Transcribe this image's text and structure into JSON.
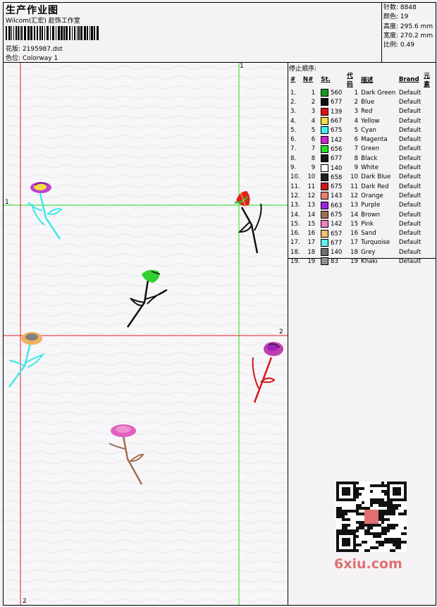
{
  "header": {
    "title": "生产作业图",
    "subtitle": "Wilcom(汇宏) 趁饰工作室",
    "design_label": "花版:",
    "design_value": "2195987.dst",
    "colorway_label": "色位:",
    "colorway_value": "Colorway 1"
  },
  "stats": [
    {
      "label": "针数:",
      "value": "8848"
    },
    {
      "label": "颜色:",
      "value": "19"
    },
    {
      "label": "高度:",
      "value": "295.6 mm"
    },
    {
      "label": "宽度:",
      "value": "270.2 mm"
    },
    {
      "label": "比例:",
      "value": "0.49"
    }
  ],
  "stop_sequence_label": "停止顺序:",
  "columns": [
    "#",
    "N#",
    "St.",
    "代码",
    "描述",
    "Brand",
    "元素"
  ],
  "threads": [
    {
      "idx": "1.",
      "n": "1",
      "color": "#1a9a1a",
      "st": "560",
      "code": "1",
      "desc": "Dark Green",
      "brand": "Default"
    },
    {
      "idx": "2.",
      "n": "2",
      "color": "#101010",
      "st": "677",
      "code": "2",
      "desc": "Blue",
      "brand": "Default"
    },
    {
      "idx": "3.",
      "n": "3",
      "color": "#e01010",
      "st": "139",
      "code": "3",
      "desc": "Red",
      "brand": "Default"
    },
    {
      "idx": "4.",
      "n": "4",
      "color": "#f4e040",
      "st": "667",
      "code": "4",
      "desc": "Yellow",
      "brand": "Default"
    },
    {
      "idx": "5.",
      "n": "5",
      "color": "#40f0f0",
      "st": "675",
      "code": "5",
      "desc": "Cyan",
      "brand": "Default"
    },
    {
      "idx": "6.",
      "n": "6",
      "color": "#d020d0",
      "st": "142",
      "code": "6",
      "desc": "Magenta",
      "brand": "Default"
    },
    {
      "idx": "7.",
      "n": "7",
      "color": "#20e020",
      "st": "656",
      "code": "7",
      "desc": "Green",
      "brand": "Default"
    },
    {
      "idx": "8.",
      "n": "8",
      "color": "#181818",
      "st": "677",
      "code": "8",
      "desc": "Black",
      "brand": "Default"
    },
    {
      "idx": "9.",
      "n": "9",
      "color": "#ffffff",
      "st": "140",
      "code": "9",
      "desc": "White",
      "brand": "Default"
    },
    {
      "idx": "10.",
      "n": "10",
      "color": "#202020",
      "st": "658",
      "code": "10",
      "desc": "Dark Blue",
      "brand": "Default"
    },
    {
      "idx": "11.",
      "n": "11",
      "color": "#c81818",
      "st": "675",
      "code": "11",
      "desc": "Dark Red",
      "brand": "Default"
    },
    {
      "idx": "12.",
      "n": "12",
      "color": "#e88070",
      "st": "143",
      "code": "12",
      "desc": "Orange",
      "brand": "Default"
    },
    {
      "idx": "13.",
      "n": "13",
      "color": "#a020e0",
      "st": "663",
      "code": "13",
      "desc": "Purple",
      "brand": "Default"
    },
    {
      "idx": "14.",
      "n": "14",
      "color": "#a07050",
      "st": "675",
      "code": "14",
      "desc": "Brown",
      "brand": "Default"
    },
    {
      "idx": "15.",
      "n": "15",
      "color": "#f080c0",
      "st": "142",
      "code": "15",
      "desc": "Pink",
      "brand": "Default"
    },
    {
      "idx": "16.",
      "n": "16",
      "color": "#f0c070",
      "st": "657",
      "code": "16",
      "desc": "Sand",
      "brand": "Default"
    },
    {
      "idx": "17.",
      "n": "17",
      "color": "#60f0f0",
      "st": "677",
      "code": "17",
      "desc": "Turquoise",
      "brand": "Default"
    },
    {
      "idx": "18.",
      "n": "18",
      "color": "#707070",
      "st": "140",
      "code": "18",
      "desc": "Grey",
      "brand": "Default"
    },
    {
      "idx": "19.",
      "n": "19",
      "color": "#909090",
      "st": "83",
      "code": "19",
      "desc": "Khaki",
      "brand": "Default"
    }
  ],
  "guides": {
    "green_label": "1",
    "red_label": "2"
  },
  "watermark": "6xiu.com"
}
